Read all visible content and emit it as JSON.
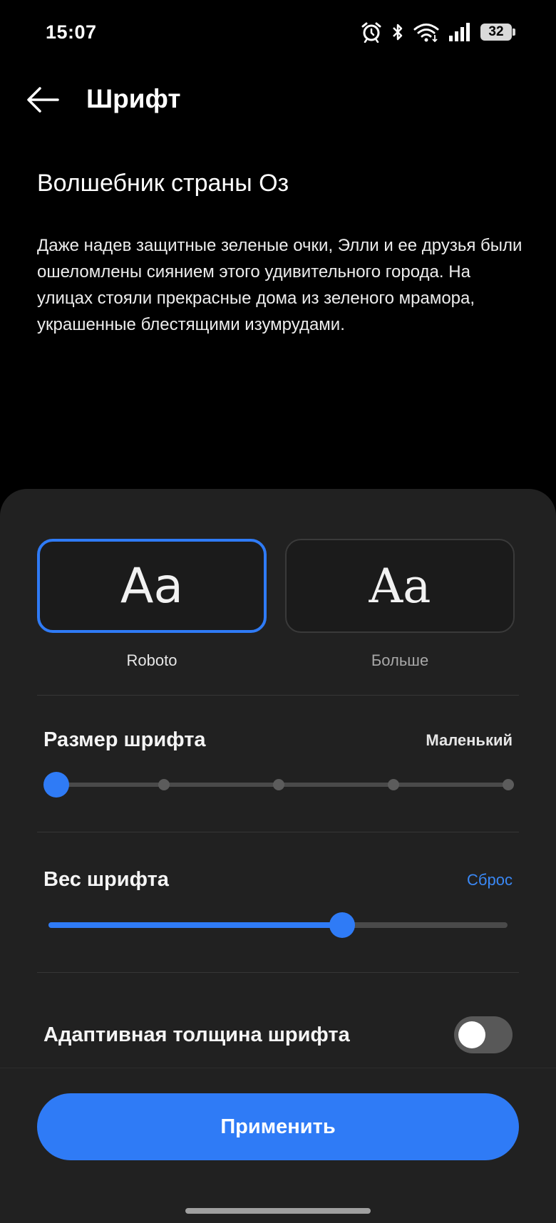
{
  "status_bar": {
    "time": "15:07",
    "battery": "32",
    "icons": [
      "alarm-icon",
      "bluetooth-icon",
      "wifi-icon",
      "signal-icon",
      "battery-icon"
    ]
  },
  "header": {
    "title": "Шрифт",
    "back_icon": "arrow-left-icon"
  },
  "preview": {
    "title": "Волшебник страны Оз",
    "text": "Даже надев защитные зеленые очки, Элли и ее друзья были ошеломлены сиянием этого удивительного города. На улицах стояли прекрасные дома из зеленого мрамора, украшенные блестящими изумрудами."
  },
  "font_options": [
    {
      "sample": "Aa",
      "label": "Roboto",
      "selected": true
    },
    {
      "sample": "Aa",
      "label": "Больше",
      "selected": false
    }
  ],
  "font_size": {
    "title": "Размер шрифта",
    "value": "Маленький",
    "steps": 5,
    "selected_step": 0
  },
  "font_weight": {
    "title": "Вес шрифта",
    "reset_label": "Сброс",
    "level": 0.64
  },
  "adaptive_weight": {
    "title": "Адаптивная толщина шрифта",
    "enabled": false
  },
  "apply_button": {
    "label": "Применить"
  },
  "colors": {
    "accent": "#2f7bf6",
    "sheet_background": "#212121",
    "background": "#000000"
  }
}
